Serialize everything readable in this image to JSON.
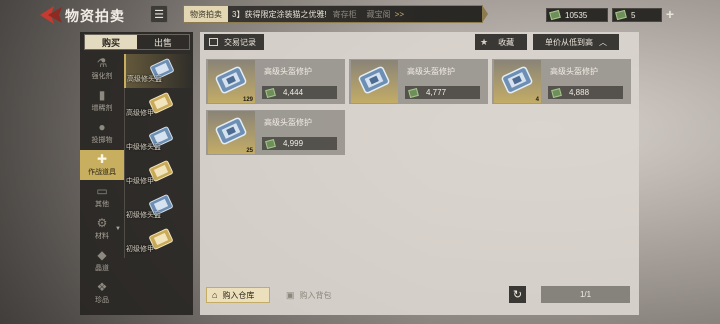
{
  "header": {
    "title": "物资拍卖",
    "ticker_tag": "物资拍卖",
    "ticker_text": "3】获得限定涂装猫之优雅!",
    "ticker_dim": "寄存柜",
    "ticker_right": "藏宝阁",
    "ticker_arrows": ">>"
  },
  "currency": {
    "cash": "10535",
    "gold": "5"
  },
  "tabs": [
    {
      "label": "购买"
    },
    {
      "label": "出售"
    }
  ],
  "categories": [
    {
      "label": "强化剂",
      "icon": "flask-icon"
    },
    {
      "label": "增稀剂",
      "icon": "tube-icon"
    },
    {
      "label": "投掷物",
      "icon": "grenade-icon"
    },
    {
      "label": "作战道具",
      "icon": "medkit-icon"
    },
    {
      "label": "其他",
      "icon": "box-icon"
    },
    {
      "label": "材料",
      "icon": "gear-icon"
    },
    {
      "label": "晶道",
      "icon": "crystal-icon"
    },
    {
      "label": "珍品",
      "icon": "gem-icon"
    }
  ],
  "subitems": [
    {
      "label": "高级修头盔"
    },
    {
      "label": "高级修甲"
    },
    {
      "label": "中级修头盔"
    },
    {
      "label": "中级修甲"
    },
    {
      "label": "初级修头盔"
    },
    {
      "label": "初级修甲"
    }
  ],
  "toolbar": {
    "records": "交易记录",
    "favorite": "收藏",
    "sort": "单价从低到高"
  },
  "listings": [
    {
      "name": "高级头盔修护",
      "count": "129",
      "price": "4,444"
    },
    {
      "name": "高级头盔修护",
      "count": "",
      "price": "4,777"
    },
    {
      "name": "高级头盔修护",
      "count": "4",
      "price": "4,888"
    },
    {
      "name": "高级头盔修护",
      "count": "25",
      "price": "4,999"
    }
  ],
  "footer": {
    "buy_warehouse": "购入仓库",
    "buy_bag": "购入背包",
    "page": "1/1"
  },
  "colors": {
    "accent_gold": "#c8ae5f",
    "panel_dark": "#2c2a27",
    "cash_green": "#6e8e5a"
  }
}
